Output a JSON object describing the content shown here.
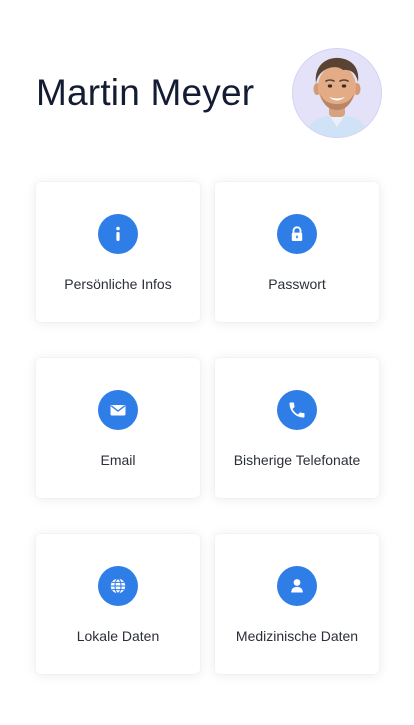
{
  "profile": {
    "name": "Martin Meyer",
    "avatar_icon": "user-photo-avatar"
  },
  "tiles": [
    {
      "label": "Persönliche Infos",
      "icon": "info-icon"
    },
    {
      "label": "Passwort",
      "icon": "lock-icon"
    },
    {
      "label": "Email",
      "icon": "envelope-icon"
    },
    {
      "label": "Bisherige Telefonate",
      "icon": "phone-icon"
    },
    {
      "label": "Lokale Daten",
      "icon": "globe-icon"
    },
    {
      "label": "Medizinische Daten",
      "icon": "person-icon"
    }
  ],
  "colors": {
    "accent": "#2f7ee8",
    "title_text": "#141c33",
    "label_text": "#2b2f3a",
    "avatar_ring": "#e5e4fb"
  }
}
